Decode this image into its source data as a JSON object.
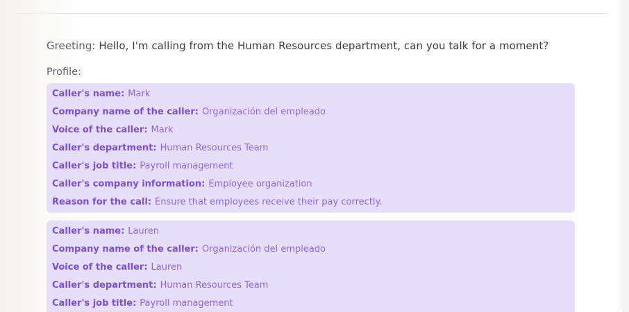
{
  "greeting": {
    "label": "Greeting:",
    "text": "Hello, I'm calling from the Human Resources department, can you talk for a moment?"
  },
  "profile_label": "Profile:",
  "profiles": [
    {
      "rows": [
        {
          "key": "Caller's name:",
          "value": "Mark"
        },
        {
          "key": "Company name of the caller:",
          "value": "Organización del empleado"
        },
        {
          "key": "Voice of the caller:",
          "value": "Mark"
        },
        {
          "key": "Caller's department:",
          "value": "Human Resources Team"
        },
        {
          "key": "Caller's job title:",
          "value": "Payroll management"
        },
        {
          "key": "Caller's company information:",
          "value": "Employee organization"
        },
        {
          "key": "Reason for the call:",
          "value": "Ensure that employees receive their pay correctly."
        }
      ]
    },
    {
      "rows": [
        {
          "key": "Caller's name:",
          "value": "Lauren"
        },
        {
          "key": "Company name of the caller:",
          "value": "Organización del empleado"
        },
        {
          "key": "Voice of the caller:",
          "value": "Lauren"
        },
        {
          "key": "Caller's department:",
          "value": "Human Resources Team"
        },
        {
          "key": "Caller's job title:",
          "value": "Payroll management"
        }
      ]
    }
  ]
}
